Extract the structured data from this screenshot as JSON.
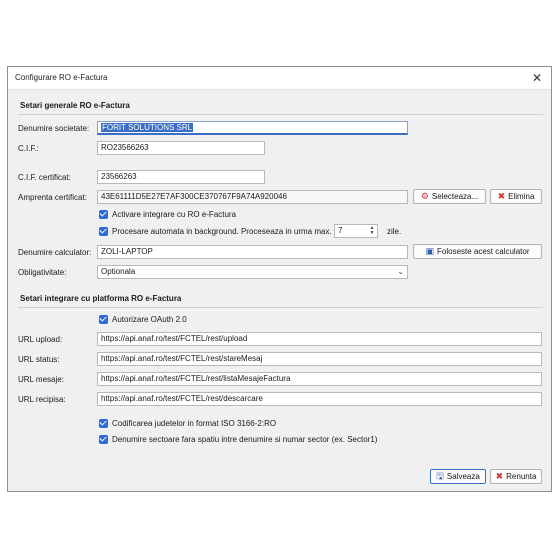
{
  "window": {
    "title": "Configurare RO e-Factura"
  },
  "general": {
    "section_title": "Setari generale RO e-Factura",
    "company_label": "Denumire societate:",
    "company_value": "FORIT SOLUTIONS SRL",
    "cif_label": "C.I.F.:",
    "cif_value": "RO23566263",
    "cert_cif_label": "C.I.F. certificat:",
    "cert_cif_value": "23566263",
    "fingerprint_label": "Amprenta certificat:",
    "fingerprint_value": "43E61111D5E27E7AF300CE370767F9A74A920046",
    "select_button": "Selecteaza...",
    "remove_button": "Elimina",
    "enable_label": "Activare integrare cu RO e-Factura",
    "background_label": "Procesare automata in background. Proceseaza in urma max.",
    "background_days": "7",
    "days_unit": "zile.",
    "computer_label": "Denumire calculator:",
    "computer_value": "ZOLI-LAPTOP",
    "use_computer_button": "Foloseste acest calculator",
    "mandatory_label": "Obligativitate:",
    "mandatory_value": "Optionala"
  },
  "integration": {
    "section_title": "Setari integrare cu platforma RO e-Factura",
    "oauth_label": "Autorizare OAuth 2.0",
    "upload_label": "URL upload:",
    "upload_value": "https://api.anaf.ro/test/FCTEL/rest/upload",
    "status_label": "URL status:",
    "status_value": "https://api.anaf.ro/test/FCTEL/rest/stareMesaj",
    "messages_label": "URL mesaje:",
    "messages_value": "https://api.anaf.ro/test/FCTEL/rest/listaMesajeFactura",
    "receipt_label": "URL recipisa:",
    "receipt_value": "https://api.anaf.ro/test/FCTEL/rest/descarcare",
    "iso_label": "Codificarea judetelor in format ISO 3166-2:RO",
    "sector_label": "Denumire sectoare fara spatiu intre denumire si numar sector (ex. Sector1)"
  },
  "footer": {
    "save_button": "Salveaza",
    "cancel_button": "Renunta"
  },
  "colors": {
    "accent": "#3b6fc5",
    "checkbox": "#2d6ad6",
    "danger": "#c83a3a"
  }
}
